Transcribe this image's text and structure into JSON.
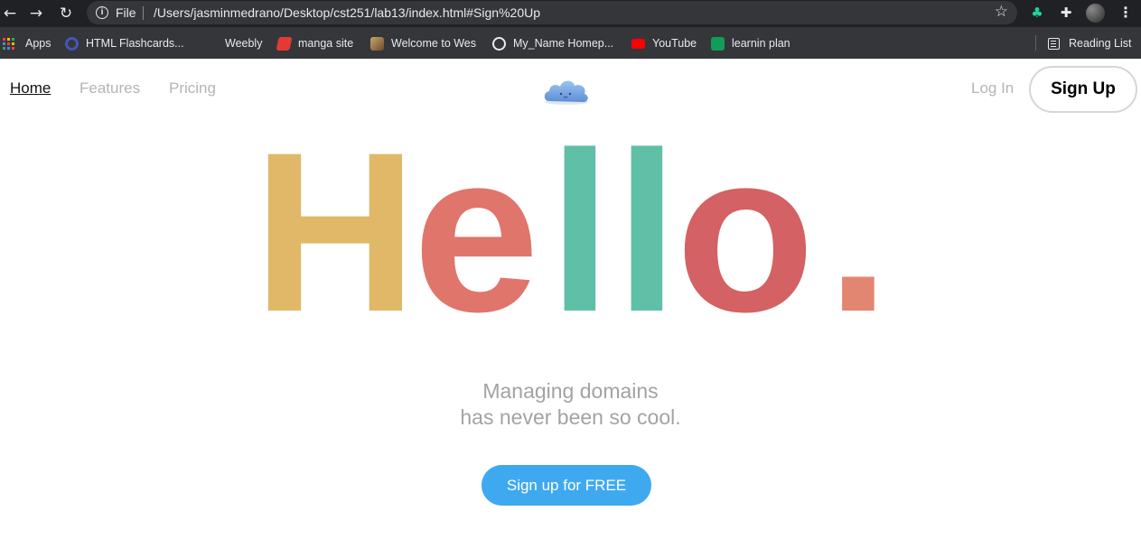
{
  "browser": {
    "file_label": "File",
    "url": "/Users/jasminmedrano/Desktop/cst251/lab13/index.html#Sign%20Up",
    "bookmarks": [
      {
        "label": "Apps",
        "icon": "apps-grid-icon"
      },
      {
        "label": "HTML Flashcards...",
        "icon": "quizlet-icon",
        "color": "#4257b2"
      },
      {
        "label": "Weebly",
        "icon": "weebly-icon"
      },
      {
        "label": "manga site",
        "icon": "manga-site-icon",
        "color": "#e53935"
      },
      {
        "label": "Welcome to Wes",
        "icon": "page-thumbnail-icon"
      },
      {
        "label": "My_Name Homep...",
        "icon": "globe-icon"
      },
      {
        "label": "YouTube",
        "icon": "youtube-icon",
        "color": "#ff0000"
      },
      {
        "label": "learnin plan",
        "icon": "sheets-icon",
        "color": "#0f9d58"
      }
    ],
    "reading_list": "Reading List"
  },
  "nav": {
    "links": [
      "Home",
      "Features",
      "Pricing"
    ],
    "login": "Log In",
    "signup": "Sign Up"
  },
  "hero": {
    "letters": [
      {
        "char": "H",
        "color": "#e0b867"
      },
      {
        "char": "e",
        "color": "#e0756c"
      },
      {
        "char": "l",
        "color": "#5fbfa7"
      },
      {
        "char": "l",
        "color": "#5fbfa7"
      },
      {
        "char": "o",
        "color": "#d46163"
      },
      {
        "char": ".",
        "color": "#e28672"
      }
    ],
    "subtitle_line1": "Managing domains",
    "subtitle_line2": "has never been so cool.",
    "cta": "Sign up for FREE"
  },
  "colors": {
    "cta": "#3fa9f0",
    "nav_inactive": "#b5b5b5"
  }
}
